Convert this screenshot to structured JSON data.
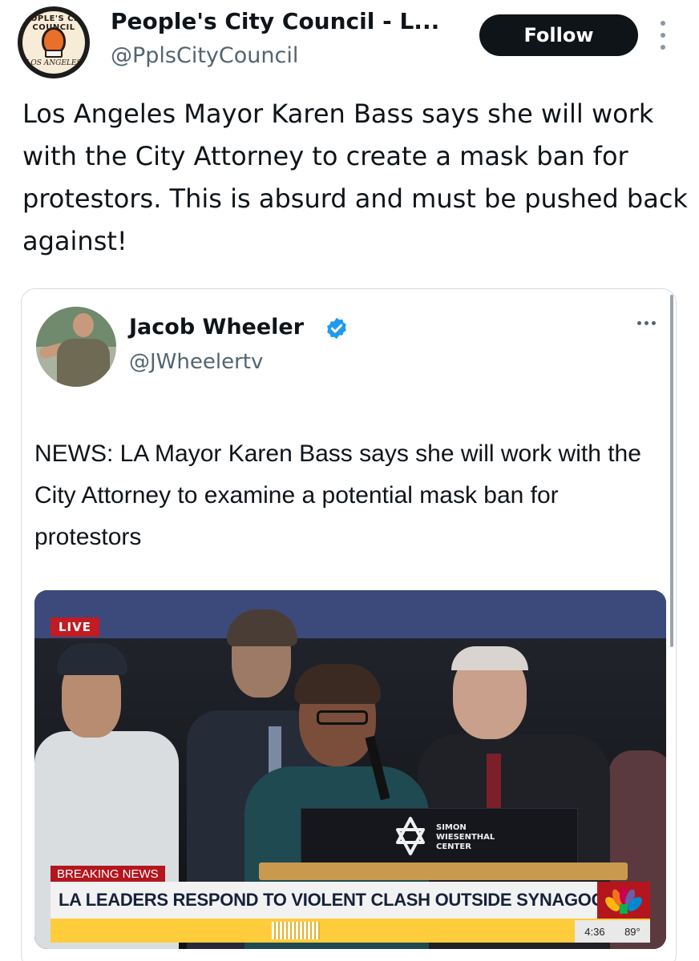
{
  "post": {
    "author_name": "People's City Council - L...",
    "author_handle": "@PplsCityCouncil",
    "follow_label": "Follow",
    "text": "Los Angeles Mayor Karen Bass says she will work with the City Attorney to create a mask ban for protestors. This is absurd and must be pushed back against!",
    "avatar_logo_top": "PEOPLE'S CITY COUNCIL",
    "avatar_logo_bottom": "LOS ANGELES"
  },
  "quote": {
    "author_name": "Jacob Wheeler",
    "author_handle": "@JWheelertv",
    "verified": true,
    "text": "NEWS: LA Mayor Karen Bass says she will work with the City Attorney to examine a potential mask ban for protestors",
    "media": {
      "live_label": "LIVE",
      "breaking_label": "BREAKING NEWS",
      "headline": "LA LEADERS RESPOND TO VIOLENT CLASH OUTSIDE SYNAGOGUE",
      "podium_text": "SIMON\nWIESENTHAL\nCENTER",
      "time": "4:36",
      "temperature": "89°"
    }
  },
  "colors": {
    "follow_bg": "#0f1419",
    "verified_blue": "#1d9bf0",
    "live_red": "#c21b22",
    "ticker_yellow": "#ffcc3b"
  }
}
